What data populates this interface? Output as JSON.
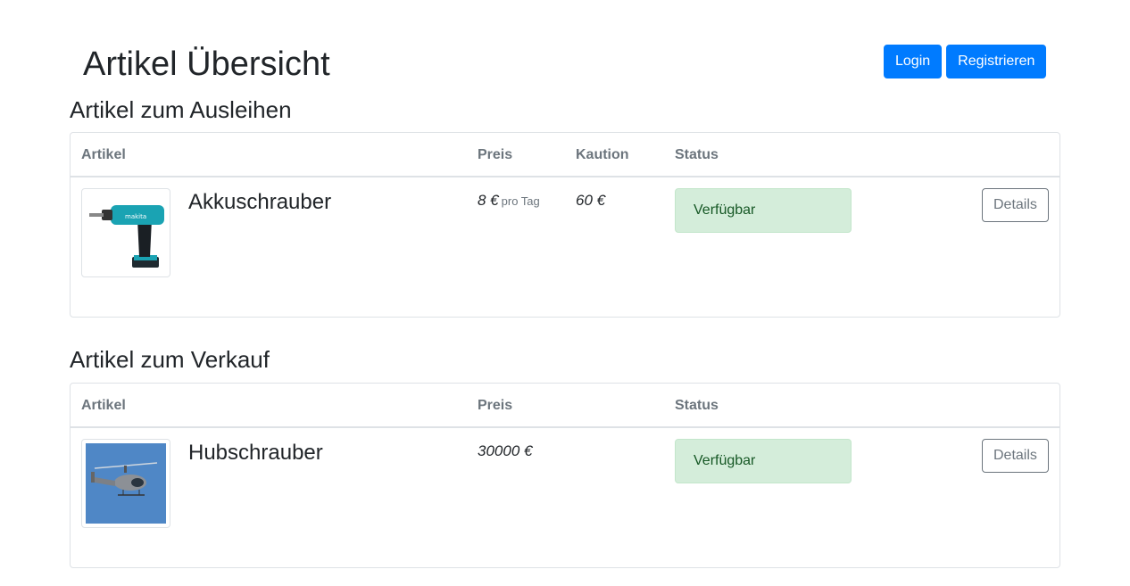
{
  "header": {
    "title": "Artikel Übersicht",
    "login_label": "Login",
    "register_label": "Registrieren"
  },
  "rent_section": {
    "title": "Artikel zum Ausleihen",
    "columns": {
      "artikel": "Artikel",
      "preis": "Preis",
      "kaution": "Kaution",
      "status": "Status"
    },
    "items": [
      {
        "name": "Akkuschrauber",
        "price": "8 €",
        "price_unit": "pro Tag",
        "deposit": "60 €",
        "status": "Verfügbar",
        "details_label": "Details",
        "image_icon": "drill-image"
      }
    ]
  },
  "sale_section": {
    "title": "Artikel zum Verkauf",
    "columns": {
      "artikel": "Artikel",
      "preis": "Preis",
      "status": "Status"
    },
    "items": [
      {
        "name": "Hubschrauber",
        "price": "30000 €",
        "status": "Verfügbar",
        "details_label": "Details",
        "image_icon": "helicopter-image"
      }
    ]
  },
  "colors": {
    "primary": "#007bff",
    "success_bg": "#d4edda",
    "success_text": "#155724",
    "secondary": "#6c757d"
  }
}
